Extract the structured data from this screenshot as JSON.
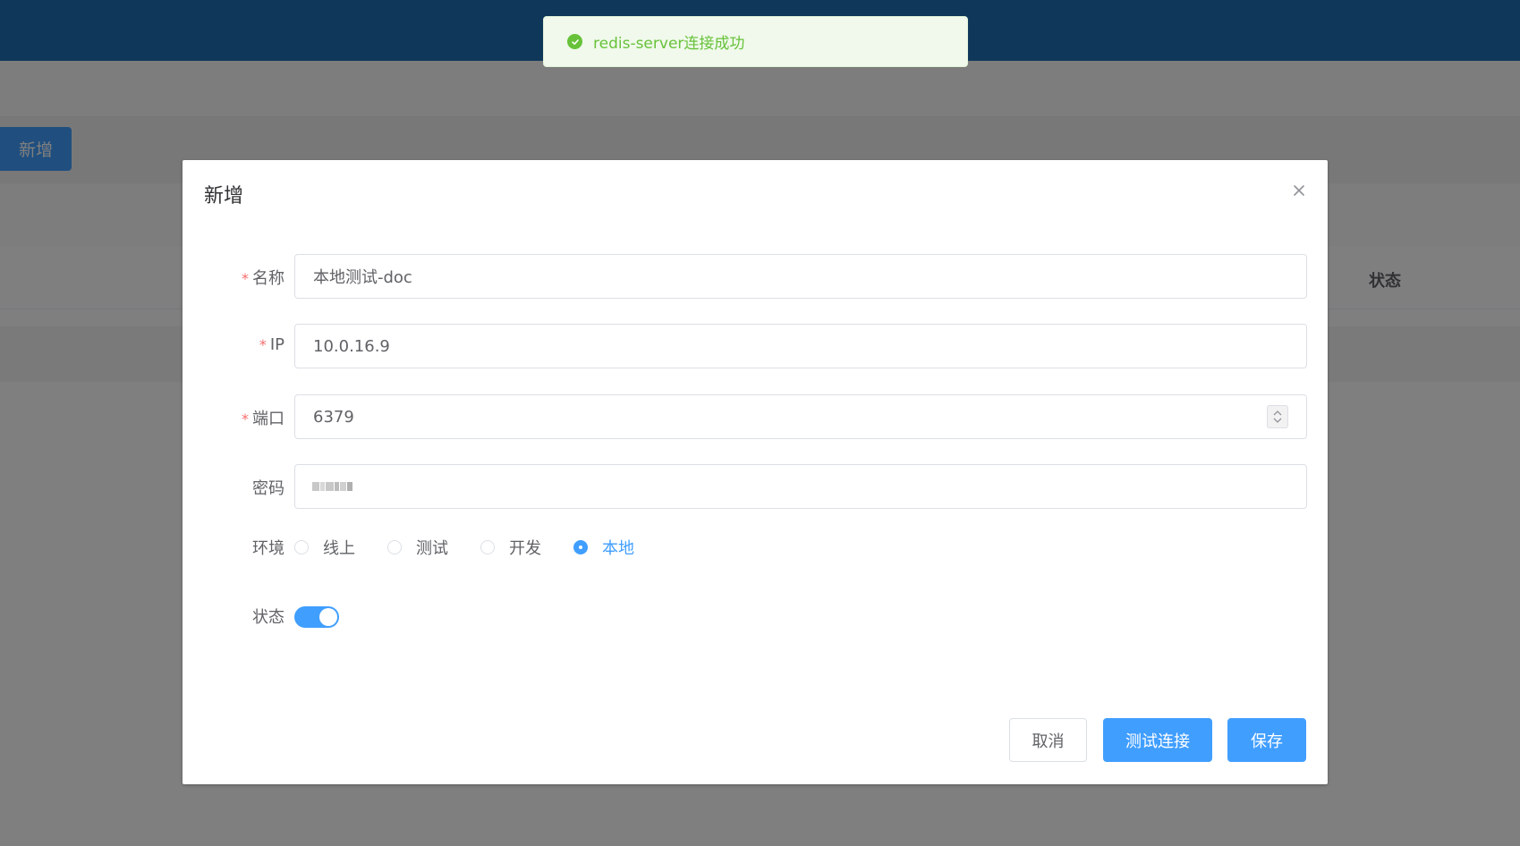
{
  "toast": {
    "message": "redis-server连接成功",
    "icon": "check-circle-icon",
    "color": "#67c23a"
  },
  "background": {
    "add_button": "新增",
    "status_column": "状态",
    "topbar_color": "#1f6fb5"
  },
  "dialog": {
    "title": "新增",
    "close_icon": "close-icon",
    "fields": {
      "name": {
        "label": "名称",
        "required": true,
        "value": "本地测试-doc"
      },
      "ip": {
        "label": "IP",
        "required": true,
        "value": "10.0.16.9"
      },
      "port": {
        "label": "端口",
        "required": true,
        "value": "6379"
      },
      "password": {
        "label": "密码",
        "required": false,
        "value": ""
      }
    },
    "env": {
      "label": "环境",
      "options": [
        "线上",
        "测试",
        "开发",
        "本地"
      ],
      "selected": "本地"
    },
    "status": {
      "label": "状态",
      "enabled": true
    },
    "buttons": {
      "cancel": "取消",
      "test": "测试连接",
      "save": "保存"
    },
    "accent_color": "#409eff"
  }
}
